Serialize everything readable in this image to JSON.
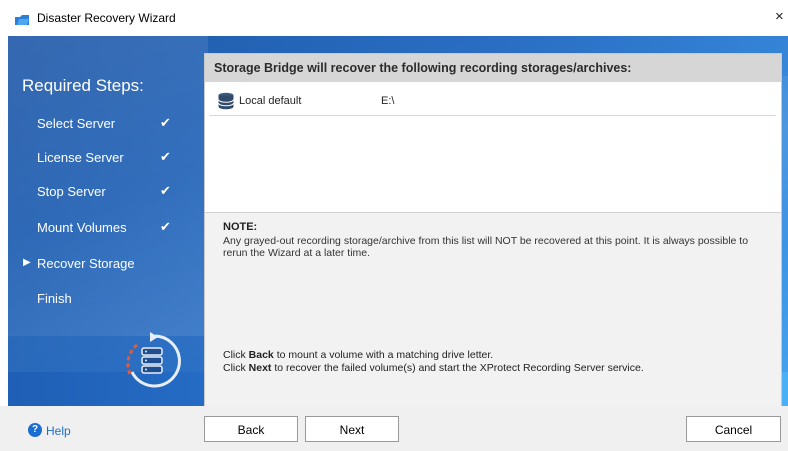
{
  "window": {
    "title": "Disaster Recovery Wizard",
    "close_glyph": "×"
  },
  "sidebar": {
    "title": "Required Steps:",
    "steps": [
      {
        "label": "Select Server",
        "done": true
      },
      {
        "label": "License Server",
        "done": true
      },
      {
        "label": "Stop Server",
        "done": true
      },
      {
        "label": "Mount Volumes",
        "done": true
      },
      {
        "label": "Recover Storage",
        "current": true
      },
      {
        "label": "Finish"
      }
    ],
    "check_glyph": "✔",
    "current_glyph": "▶"
  },
  "panel": {
    "header": "Storage Bridge will recover the following recording storages/archives:",
    "rows": [
      {
        "name": "Local default",
        "drive": "E:\\"
      }
    ],
    "note_title": "NOTE:",
    "note_body": "Any grayed-out recording storage/archive from this list will NOT be recovered at this point. It is always possible to rerun the Wizard at a later time.",
    "hint_back_prefix": "Click",
    "hint_back_key": "Back",
    "hint_back_suffix": " to mount a volume with a matching drive letter.",
    "hint_next_prefix": "Click",
    "hint_next_key": "Next",
    "hint_next_suffix": " to recover the failed volume(s) and start the XProtect Recording Server service."
  },
  "footer": {
    "help_label": "Help",
    "help_glyph": "?",
    "back_label": "Back",
    "next_label": "Next",
    "cancel_label": "Cancel"
  },
  "colors": {
    "accent": "#2a6fc4",
    "help_link": "#1c6fd0"
  }
}
